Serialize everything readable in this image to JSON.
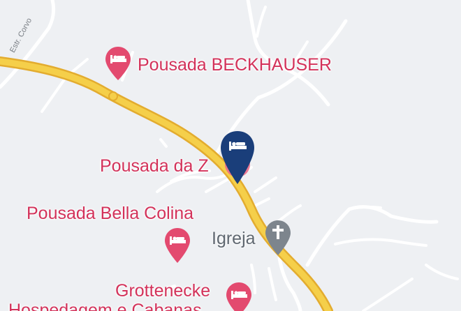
{
  "map": {
    "road_label": "Estr. Corvo",
    "pois": [
      {
        "label": "Pousada BECKHAUSER",
        "icon": "hotel-icon"
      },
      {
        "label": "Pousada da Z",
        "icon": "hotel-icon"
      },
      {
        "label": "Pousada Bella Colina",
        "icon": "hotel-icon"
      },
      {
        "label": "Grottenecke",
        "icon": "hotel-icon"
      },
      {
        "label": "Hospedagem e Cabanas",
        "icon": "hotel-icon"
      }
    ],
    "church": {
      "label": "Igreja",
      "icon": "cross-icon"
    },
    "selected_marker": {
      "icon": "bed-icon",
      "color": "#1a3e7a"
    },
    "colors": {
      "poi": "#d3325a",
      "road_main": "#f5cf4a",
      "road_edge": "#e3ac2f",
      "background": "#eef0f3"
    }
  }
}
